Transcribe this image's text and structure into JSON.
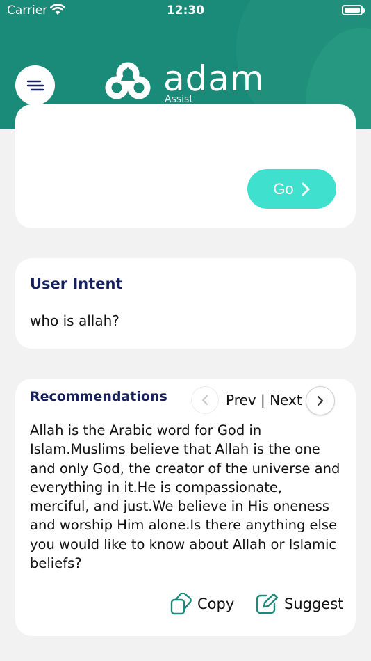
{
  "status_bar": {
    "carrier": "Carrier",
    "time": "12:30"
  },
  "header": {
    "brand_name": "adam",
    "brand_sub": "Assist",
    "menu_icon": "menu-lines-icon",
    "logo_icon": "adam-logo-icon"
  },
  "input_card": {
    "go_label": "Go",
    "go_icon": "chevron-right-icon"
  },
  "intent_card": {
    "title": "User Intent",
    "text": "who is allah?"
  },
  "recommendations": {
    "title": "Recommendations",
    "pager_label": "Prev | Next",
    "text": "Allah is the Arabic word for God in Islam.Muslims believe that Allah is the one and only God, the creator of the universe and everything in it.He is compassionate, merciful, and just.We believe in His oneness and worship Him alone.Is there anything else you would like to know about Allah or Islamic beliefs?",
    "copy_label": "Copy",
    "suggest_label": "Suggest"
  },
  "colors": {
    "header": "#1a8b78",
    "accent": "#3fe0cd",
    "title": "#16205c",
    "icon": "#1a8b78"
  }
}
